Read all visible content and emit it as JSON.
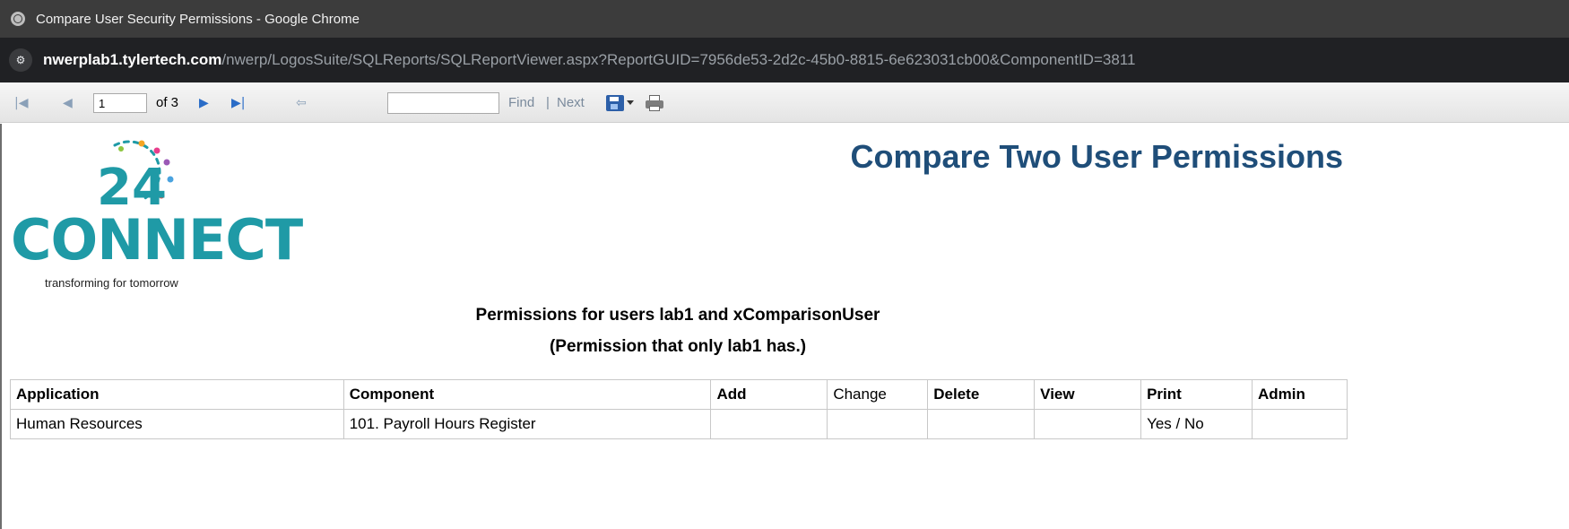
{
  "window": {
    "title": "Compare User Security Permissions - Google Chrome"
  },
  "address_bar": {
    "host": "nwerplab1.tylertech.com",
    "path": "/nwerp/LogosSuite/SQLReports/SQLReportViewer.aspx?ReportGUID=7956de53-2d2c-45b0-8815-6e623031cb00&ComponentID=3811"
  },
  "toolbar": {
    "current_page": "1",
    "page_count_label": "of 3",
    "find_label": "Find",
    "separator": "|",
    "next_label": "Next",
    "find_placeholder": ""
  },
  "report": {
    "logo": {
      "number": "24",
      "word": "CONNECT",
      "tagline": "transforming for tomorrow"
    },
    "title": "Compare Two User Permissions",
    "subtitle": "Permissions for users lab1 and xComparisonUser",
    "subtitle2": "(Permission that only lab1 has.)",
    "table": {
      "headers": [
        "Application",
        "Component",
        "Add",
        "Change",
        "Delete",
        "View",
        "Print",
        "Admin"
      ],
      "rows": [
        [
          "Human Resources",
          "101. Payroll Hours Register",
          "",
          "",
          "",
          "",
          "Yes / No",
          ""
        ]
      ]
    }
  },
  "icons": {
    "first_page": "first-page-icon",
    "prev_page": "previous-page-icon",
    "next_page": "next-page-icon",
    "last_page": "last-page-icon",
    "back": "back-to-parent-icon",
    "export": "save-export-icon",
    "print": "print-icon",
    "site_info": "site-info-icon",
    "window": "chrome-window-icon"
  },
  "colors": {
    "title_blue": "#1f4e79",
    "logo_teal": "#1f9aa6",
    "chrome_dark": "#202124"
  }
}
